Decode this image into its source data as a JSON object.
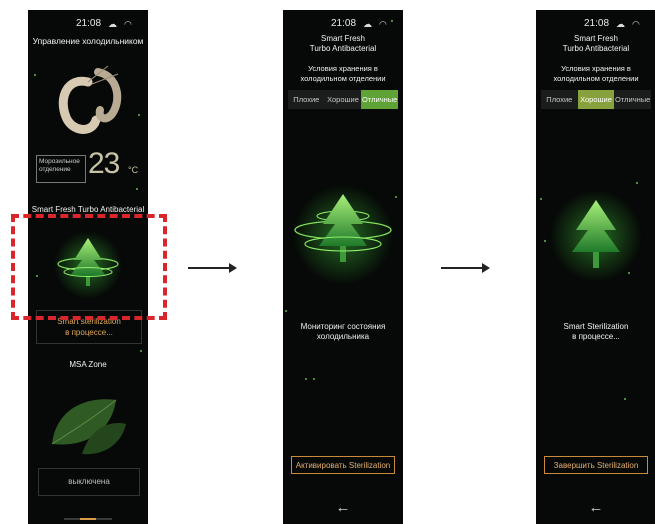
{
  "status_bar": {
    "time": "21:08"
  },
  "screen1": {
    "header": "Управление холодильником",
    "freezer": {
      "label": "Морозильное отделение",
      "temp": "23",
      "unit": "°C"
    },
    "section_title": "Smart Fresh Turbo Antibacterial",
    "status_line1": "Smart sterilization",
    "status_line2": "в процессе...",
    "msa_title": "MSA Zone",
    "msa_status": "выключена"
  },
  "screen2": {
    "title_line1": "Smart Fresh",
    "title_line2": "Turbo Antibacterial",
    "subtitle_line1": "Условия хранения в",
    "subtitle_line2": "холодильном отделении",
    "segments": [
      "Плохие",
      "Хорошие",
      "Отличные"
    ],
    "selected_segment": "Отличные",
    "message_line1": "Мониторинг состояния",
    "message_line2": "холодильника",
    "button": "Активировать Sterilization"
  },
  "screen3": {
    "title_line1": "Smart Fresh",
    "title_line2": "Turbo Antibacterial",
    "subtitle_line1": "Условия хранения в",
    "subtitle_line2": "холодильном отделении",
    "segments": [
      "Плохие",
      "Хорошие",
      "Отличные"
    ],
    "selected_segment": "Хорошие",
    "message_line1": "Smart Sterilization",
    "message_line2": "в процессе...",
    "button": "Завершить Sterilization"
  },
  "colors": {
    "accent_green": "#5fa336",
    "highlight_red": "#d9262c",
    "button_orange": "#c98a3c"
  }
}
